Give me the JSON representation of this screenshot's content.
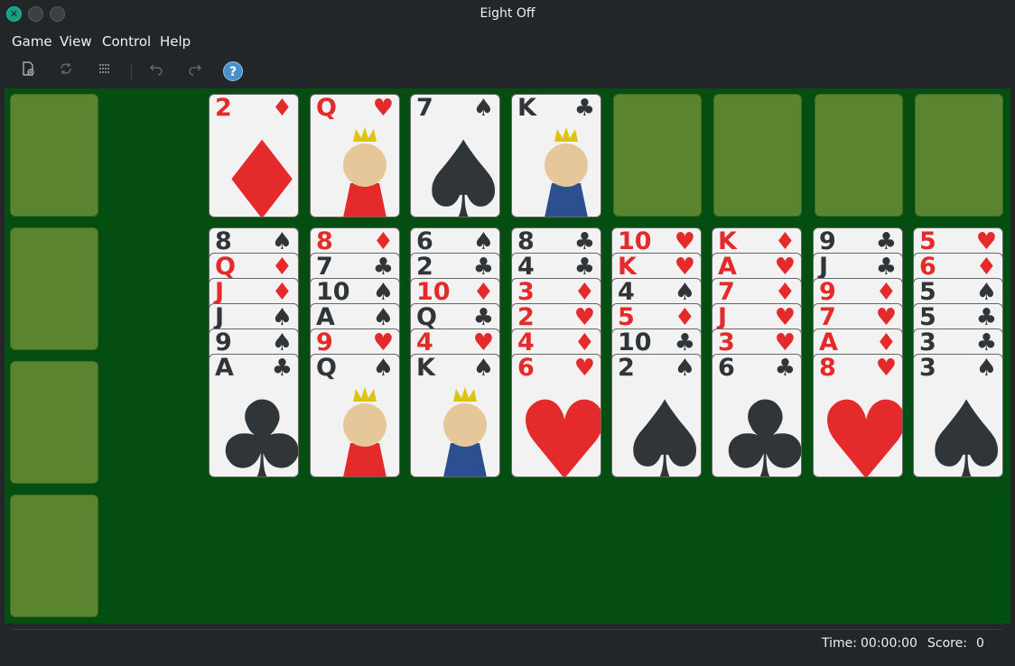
{
  "window": {
    "title": "Eight Off"
  },
  "menubar": {
    "items": [
      "Game",
      "View",
      "Control",
      "Help"
    ]
  },
  "toolbar": {
    "icons": [
      "new-game-icon",
      "restart-icon",
      "deal-icon",
      "undo-icon",
      "redo-icon",
      "help-icon"
    ],
    "help_glyph": "?"
  },
  "colors": {
    "felt": "#044e12",
    "slot": "#5b8431",
    "red": "#e42a2a",
    "black": "#2f3538"
  },
  "reserve_top": [
    {
      "rank": "2",
      "suit": "♦",
      "color": "red"
    },
    {
      "rank": "Q",
      "suit": "♥",
      "color": "red"
    },
    {
      "rank": "7",
      "suit": "♠",
      "color": "black"
    },
    {
      "rank": "K",
      "suit": "♣",
      "color": "black"
    }
  ],
  "tableau": [
    [
      {
        "rank": "8",
        "suit": "♠",
        "color": "black"
      },
      {
        "rank": "Q",
        "suit": "♦",
        "color": "red"
      },
      {
        "rank": "J",
        "suit": "♦",
        "color": "red"
      },
      {
        "rank": "J",
        "suit": "♠",
        "color": "black"
      },
      {
        "rank": "9",
        "suit": "♠",
        "color": "black"
      },
      {
        "rank": "A",
        "suit": "♣",
        "color": "black"
      }
    ],
    [
      {
        "rank": "8",
        "suit": "♦",
        "color": "red"
      },
      {
        "rank": "7",
        "suit": "♣",
        "color": "black"
      },
      {
        "rank": "10",
        "suit": "♠",
        "color": "black"
      },
      {
        "rank": "A",
        "suit": "♠",
        "color": "black"
      },
      {
        "rank": "9",
        "suit": "♥",
        "color": "red"
      },
      {
        "rank": "Q",
        "suit": "♠",
        "color": "black"
      }
    ],
    [
      {
        "rank": "6",
        "suit": "♠",
        "color": "black"
      },
      {
        "rank": "2",
        "suit": "♣",
        "color": "black"
      },
      {
        "rank": "10",
        "suit": "♦",
        "color": "red"
      },
      {
        "rank": "Q",
        "suit": "♣",
        "color": "black"
      },
      {
        "rank": "4",
        "suit": "♥",
        "color": "red"
      },
      {
        "rank": "K",
        "suit": "♠",
        "color": "black"
      }
    ],
    [
      {
        "rank": "8",
        "suit": "♣",
        "color": "black"
      },
      {
        "rank": "4",
        "suit": "♣",
        "color": "black"
      },
      {
        "rank": "3",
        "suit": "♦",
        "color": "red"
      },
      {
        "rank": "2",
        "suit": "♥",
        "color": "red"
      },
      {
        "rank": "4",
        "suit": "♦",
        "color": "red"
      },
      {
        "rank": "6",
        "suit": "♥",
        "color": "red"
      }
    ],
    [
      {
        "rank": "10",
        "suit": "♥",
        "color": "red"
      },
      {
        "rank": "K",
        "suit": "♥",
        "color": "red"
      },
      {
        "rank": "4",
        "suit": "♠",
        "color": "black"
      },
      {
        "rank": "5",
        "suit": "♦",
        "color": "red"
      },
      {
        "rank": "10",
        "suit": "♣",
        "color": "black"
      },
      {
        "rank": "2",
        "suit": "♠",
        "color": "black"
      }
    ],
    [
      {
        "rank": "K",
        "suit": "♦",
        "color": "red"
      },
      {
        "rank": "A",
        "suit": "♥",
        "color": "red"
      },
      {
        "rank": "7",
        "suit": "♦",
        "color": "red"
      },
      {
        "rank": "J",
        "suit": "♥",
        "color": "red"
      },
      {
        "rank": "3",
        "suit": "♥",
        "color": "red"
      },
      {
        "rank": "6",
        "suit": "♣",
        "color": "black"
      }
    ],
    [
      {
        "rank": "9",
        "suit": "♣",
        "color": "black"
      },
      {
        "rank": "J",
        "suit": "♣",
        "color": "black"
      },
      {
        "rank": "9",
        "suit": "♦",
        "color": "red"
      },
      {
        "rank": "7",
        "suit": "♥",
        "color": "red"
      },
      {
        "rank": "A",
        "suit": "♦",
        "color": "red"
      },
      {
        "rank": "8",
        "suit": "♥",
        "color": "red"
      }
    ],
    [
      {
        "rank": "5",
        "suit": "♥",
        "color": "red"
      },
      {
        "rank": "6",
        "suit": "♦",
        "color": "red"
      },
      {
        "rank": "5",
        "suit": "♠",
        "color": "black"
      },
      {
        "rank": "5",
        "suit": "♣",
        "color": "black"
      },
      {
        "rank": "3",
        "suit": "♣",
        "color": "black"
      },
      {
        "rank": "3",
        "suit": "♠",
        "color": "black"
      }
    ]
  ],
  "status": {
    "time_label": "Time:",
    "time_value": "00:00:00",
    "score_label": "Score:",
    "score_value": "0"
  }
}
